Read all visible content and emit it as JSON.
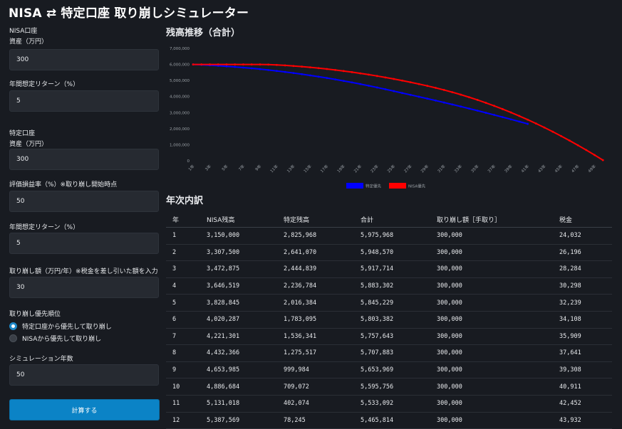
{
  "title": "NISA ⇄ 特定口座 取り崩しシミュレーター",
  "form": {
    "nisa_section": "NISA口座",
    "nisa_assets_label": "資産（万円）",
    "nisa_assets_value": "300",
    "nisa_return_label": "年間想定リターン（%）",
    "nisa_return_value": "5",
    "tokutei_section": "特定口座",
    "tokutei_assets_label": "資産（万円）",
    "tokutei_assets_value": "300",
    "gain_ratio_label": "評価損益率（%）※取り崩し開始時点",
    "gain_ratio_value": "50",
    "tokutei_return_label": "年間想定リターン（%）",
    "tokutei_return_value": "5",
    "withdraw_label": "取り崩し額（万円/年）※税金を差し引いた額を入力",
    "withdraw_value": "30",
    "priority_label": "取り崩し優先順位",
    "priority_options": [
      "特定口座から優先して取り崩し",
      "NISAから優先して取り崩し"
    ],
    "priority_selected": 0,
    "years_label": "シミュレーション年数",
    "years_value": "50",
    "calc_button": "計算する"
  },
  "chart_title": "残高推移（合計）",
  "chart_data": {
    "type": "line",
    "ylim": [
      0,
      7000000
    ],
    "y_ticks": [
      "7,000,000",
      "6,000,000",
      "5,000,000",
      "4,000,000",
      "3,000,000",
      "2,000,000",
      "1,000,000",
      "0"
    ],
    "x_ticks": [
      "1年",
      "3年",
      "5年",
      "7年",
      "9年",
      "11年",
      "13年",
      "15年",
      "17年",
      "19年",
      "21年",
      "23年",
      "25年",
      "27年",
      "29年",
      "31年",
      "33年",
      "35年",
      "37年",
      "39年",
      "41年",
      "43年",
      "45年",
      "47年",
      "49年"
    ],
    "x": [
      0,
      1,
      2,
      3,
      4,
      5,
      6,
      7,
      8,
      9,
      10,
      11,
      12,
      13,
      14,
      15,
      16,
      17,
      18,
      19,
      20,
      21,
      22,
      23,
      24,
      25,
      26,
      27,
      28,
      29,
      30,
      31,
      32,
      33,
      34,
      35,
      36,
      37,
      38,
      39,
      40,
      41,
      42,
      43,
      44,
      45,
      46,
      47,
      48,
      49,
      50
    ],
    "series": [
      {
        "name": "特定優先",
        "color": "#0000ff",
        "values": [
          6000000,
          5975968,
          5948570,
          5917714,
          5883302,
          5845229,
          5803382,
          5757643,
          5707883,
          5653969,
          5595756,
          5533092,
          5465814,
          5394000,
          5318000,
          5238000,
          5154000,
          5066000,
          4974000,
          4878000,
          4778000,
          4674000,
          4566000,
          4454000,
          4338000,
          4220000,
          4106000,
          3990000,
          3872000,
          3752000,
          3630000,
          3506000,
          3380000,
          3252000,
          3122000,
          2990000,
          2856000,
          2720000,
          2582000,
          2442000,
          2300000
        ]
      },
      {
        "name": "NISA優先",
        "color": "#ff0000",
        "values": [
          6000000,
          6000000,
          6000000,
          6000000,
          6000000,
          6000000,
          6000000,
          6000000,
          6000000,
          5990000,
          5970000,
          5940000,
          5905000,
          5865000,
          5820000,
          5770000,
          5715000,
          5655000,
          5590000,
          5520000,
          5445000,
          5365000,
          5280000,
          5190000,
          5095000,
          4995000,
          4890000,
          4780000,
          4665000,
          4540000,
          4410000,
          4270000,
          4120000,
          3960000,
          3790000,
          3610000,
          3420000,
          3220000,
          3010000,
          2790000,
          2560000,
          2320000,
          2070000,
          1810000,
          1540000,
          1260000,
          970000,
          670000,
          360000,
          40000
        ]
      }
    ],
    "legend": "bottom",
    "grid": false
  },
  "table_title": "年次内訳",
  "table": {
    "headers": [
      "年",
      "NISA残高",
      "特定残高",
      "合計",
      "取り崩し額［手取り］",
      "税金"
    ],
    "rows": [
      [
        "1",
        "3,150,000",
        "2,825,968",
        "5,975,968",
        "300,000",
        "24,032"
      ],
      [
        "2",
        "3,307,500",
        "2,641,070",
        "5,948,570",
        "300,000",
        "26,196"
      ],
      [
        "3",
        "3,472,875",
        "2,444,839",
        "5,917,714",
        "300,000",
        "28,284"
      ],
      [
        "4",
        "3,646,519",
        "2,236,784",
        "5,883,302",
        "300,000",
        "30,298"
      ],
      [
        "5",
        "3,828,845",
        "2,016,384",
        "5,845,229",
        "300,000",
        "32,239"
      ],
      [
        "6",
        "4,020,287",
        "1,783,095",
        "5,803,382",
        "300,000",
        "34,108"
      ],
      [
        "7",
        "4,221,301",
        "1,536,341",
        "5,757,643",
        "300,000",
        "35,909"
      ],
      [
        "8",
        "4,432,366",
        "1,275,517",
        "5,707,883",
        "300,000",
        "37,641"
      ],
      [
        "9",
        "4,653,985",
        "999,984",
        "5,653,969",
        "300,000",
        "39,308"
      ],
      [
        "10",
        "4,886,684",
        "709,072",
        "5,595,756",
        "300,000",
        "40,911"
      ],
      [
        "11",
        "5,131,018",
        "402,074",
        "5,533,092",
        "300,000",
        "42,452"
      ],
      [
        "12",
        "5,387,569",
        "78,245",
        "5,465,814",
        "300,000",
        "43,932"
      ]
    ]
  }
}
